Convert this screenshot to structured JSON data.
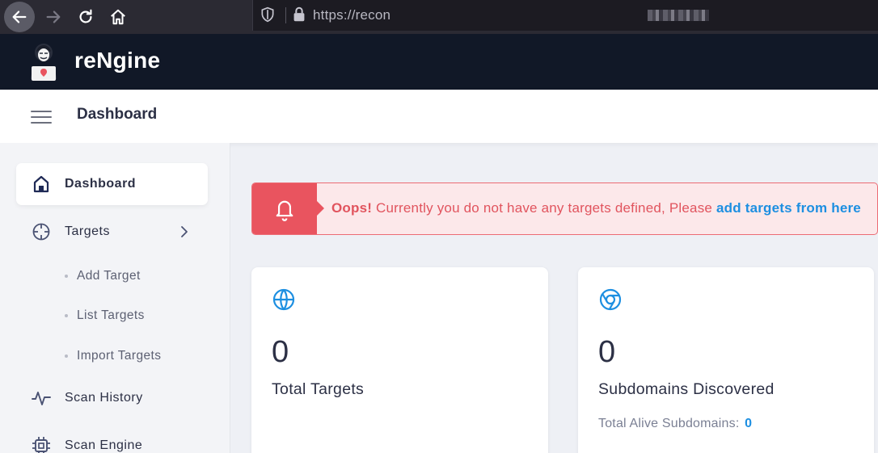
{
  "browser": {
    "url": "https://recon",
    "icons": {
      "back": "arrow-left-icon",
      "forward": "arrow-right-icon",
      "reload": "reload-icon",
      "home": "home-icon",
      "shield": "shield-icon",
      "lock": "lock-icon"
    }
  },
  "app": {
    "brand": "reNgine"
  },
  "topbar": {
    "title": "Dashboard"
  },
  "sidebar": {
    "items": [
      {
        "label": "Dashboard",
        "icon": "home-icon",
        "active": true
      },
      {
        "label": "Targets",
        "icon": "crosshair-icon",
        "expanded": true
      },
      {
        "label": "Scan History",
        "icon": "activity-icon"
      },
      {
        "label": "Scan Engine",
        "icon": "cpu-icon"
      }
    ],
    "targets_sub": [
      "Add Target",
      "List Targets",
      "Import Targets"
    ]
  },
  "alert": {
    "strong": "Oops!",
    "text": " Currently you do not have any targets defined, Please ",
    "link": "add targets from here"
  },
  "cards": [
    {
      "icon": "globe-icon",
      "value": "0",
      "title": "Total Targets"
    },
    {
      "icon": "chrome-icon",
      "value": "0",
      "title": "Subdomains Discovered",
      "sub_label": "Total Alive Subdomains:",
      "sub_value": "0"
    }
  ],
  "colors": {
    "header": "#111827",
    "alert": "#e9545f",
    "accent": "#1d8fe1",
    "text": "#2c3045"
  }
}
